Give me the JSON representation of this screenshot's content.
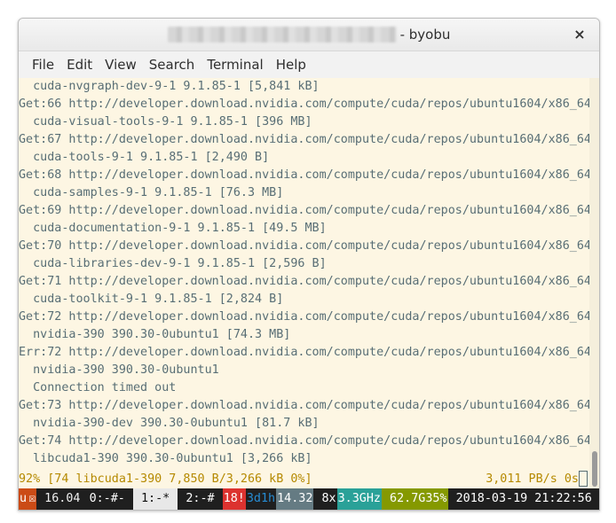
{
  "window": {
    "title_suffix": "- byobu",
    "close_glyph": "×"
  },
  "menu": [
    "File",
    "Edit",
    "View",
    "Search",
    "Terminal",
    "Help"
  ],
  "terminal_lines": [
    "  cuda-nvgraph-dev-9-1 9.1.85-1 [5,841 kB]",
    "Get:66 http://developer.download.nvidia.com/compute/cuda/repos/ubuntu1604/x86_64",
    "  cuda-visual-tools-9-1 9.1.85-1 [396 MB]",
    "Get:67 http://developer.download.nvidia.com/compute/cuda/repos/ubuntu1604/x86_64",
    "  cuda-tools-9-1 9.1.85-1 [2,490 B]",
    "Get:68 http://developer.download.nvidia.com/compute/cuda/repos/ubuntu1604/x86_64",
    "  cuda-samples-9-1 9.1.85-1 [76.3 MB]",
    "Get:69 http://developer.download.nvidia.com/compute/cuda/repos/ubuntu1604/x86_64",
    "  cuda-documentation-9-1 9.1.85-1 [49.5 MB]",
    "Get:70 http://developer.download.nvidia.com/compute/cuda/repos/ubuntu1604/x86_64",
    "  cuda-libraries-dev-9-1 9.1.85-1 [2,596 B]",
    "Get:71 http://developer.download.nvidia.com/compute/cuda/repos/ubuntu1604/x86_64",
    "  cuda-toolkit-9-1 9.1.85-1 [2,824 B]",
    "Get:72 http://developer.download.nvidia.com/compute/cuda/repos/ubuntu1604/x86_64",
    "  nvidia-390 390.30-0ubuntu1 [74.3 MB]",
    "Err:72 http://developer.download.nvidia.com/compute/cuda/repos/ubuntu1604/x86_64",
    "  nvidia-390 390.30-0ubuntu1",
    "  Connection timed out",
    "Get:73 http://developer.download.nvidia.com/compute/cuda/repos/ubuntu1604/x86_64",
    "  nvidia-390-dev 390.30-0ubuntu1 [81.7 kB]",
    "Get:74 http://developer.download.nvidia.com/compute/cuda/repos/ubuntu1604/x86_64",
    "  libcuda1-390 390.30-0ubuntu1 [3,266 kB]"
  ],
  "progress": {
    "left": "92% [74 libcuda1-390 7,850 B/3,266 kB 0%]",
    "right": "3,011 PB/s 0s"
  },
  "statusbar": [
    {
      "text": "u",
      "bg": "#cb4b16",
      "fg": "#ffffff"
    },
    {
      "text": "☒",
      "bg": "#cb4b16",
      "fg": "#ffffff"
    },
    {
      "text": " 16.04 ",
      "bg": "#1f1f1f",
      "fg": "#eeeeee"
    },
    {
      "text": "0:-#- ",
      "bg": "#1f1f1f",
      "fg": "#ffffff"
    },
    {
      "text": " 1:-* ",
      "bg": "#e8e8e8",
      "fg": "#111111"
    },
    {
      "text": " 2:-# ",
      "bg": "#1f1f1f",
      "fg": "#ffffff"
    },
    {
      "text": "18!",
      "bg": "#dc322f",
      "fg": "#ffffff"
    },
    {
      "text": "3d1h",
      "bg": "#1f1f1f",
      "fg": "#268bd2"
    },
    {
      "text": "14.32",
      "bg": "#657b83",
      "fg": "#ffffff"
    },
    {
      "text": " 8x",
      "bg": "#1f1f1f",
      "fg": "#ffffff"
    },
    {
      "text": "3.3GHz",
      "bg": "#2aa198",
      "fg": "#ffffff"
    },
    {
      "text": " 62.7G35%",
      "bg": "#859900",
      "fg": "#ffffff"
    },
    {
      "text": " 2018-03-19 21:22:56",
      "bg": "#1f1f1f",
      "fg": "#ffffff"
    }
  ],
  "colors": {
    "terminal_bg": "#fdf6e3",
    "terminal_fg": "#586e75",
    "progress_fg": "#b58900"
  }
}
